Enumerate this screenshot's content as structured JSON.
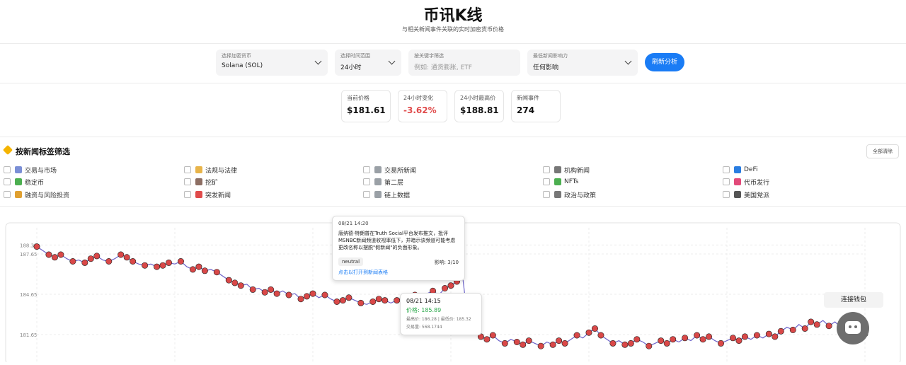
{
  "header": {
    "title": "币讯K线",
    "subtitle": "与相关新闻事件关联的实时加密货币价格"
  },
  "controls": {
    "currency": {
      "label": "选择加密货币",
      "value": "Solana (SOL)"
    },
    "timerange": {
      "label": "选择时间范围",
      "value": "24小时"
    },
    "keyword": {
      "label": "按关键字筛选",
      "placeholder": "例如: 通货膨胀, ETF"
    },
    "impact": {
      "label": "最低新闻影响力",
      "value": "任何影响"
    },
    "refresh_label": "刷新分析"
  },
  "stats": [
    {
      "label": "当前价格",
      "value": "$181.61"
    },
    {
      "label": "24小时变化",
      "value": "-3.62%"
    },
    {
      "label": "24小时最高价",
      "value": "$188.81"
    },
    {
      "label": "新闻事件",
      "value": "274"
    }
  ],
  "tags": {
    "title": "按新闻标签筛选",
    "clear_label": "全部清除",
    "items": [
      {
        "label": "交易与市场",
        "icon": "chart-icon",
        "color": "#7b8fd6"
      },
      {
        "label": "法规与法律",
        "icon": "scales-icon",
        "color": "#e8b44a"
      },
      {
        "label": "交易所新闻",
        "icon": "exchange-icon",
        "color": "#9aa0a6"
      },
      {
        "label": "机构新闻",
        "icon": "bank-icon",
        "color": "#777777"
      },
      {
        "label": "DeFi",
        "icon": "defi-icon",
        "color": "#2a7de1"
      },
      {
        "label": "稳定币",
        "icon": "money-icon",
        "color": "#4caf50"
      },
      {
        "label": "挖矿",
        "icon": "pick-icon",
        "color": "#8d6e63"
      },
      {
        "label": "第二层",
        "icon": "link-icon",
        "color": "#9aa0a6"
      },
      {
        "label": "NFTs",
        "icon": "nft-icon",
        "color": "#4caf50"
      },
      {
        "label": "代币发行",
        "icon": "rocket-icon",
        "color": "#e24a7a"
      },
      {
        "label": "融资与风险投资",
        "icon": "moneybag-icon",
        "color": "#e0a030"
      },
      {
        "label": "突发新闻",
        "icon": "alert-icon",
        "color": "#e04b4b"
      },
      {
        "label": "链上数据",
        "icon": "chain-icon",
        "color": "#9aa0a6"
      },
      {
        "label": "政治与政策",
        "icon": "bank-icon",
        "color": "#777777"
      },
      {
        "label": "美国党派",
        "icon": "us-icon",
        "color": "#555555"
      }
    ]
  },
  "chart_data": {
    "type": "line",
    "y_ticks": [
      "188.32",
      "187.65",
      "184.65",
      "181.65"
    ],
    "ylim": [
      179.6,
      189.6
    ],
    "grid": true,
    "series_color": "#6c63c9",
    "values": [
      188.2,
      187.9,
      187.6,
      187.4,
      187.6,
      187.3,
      187.1,
      187.2,
      187.0,
      187.3,
      187.5,
      187.2,
      187.1,
      187.3,
      187.6,
      187.4,
      187.1,
      186.9,
      186.8,
      186.9,
      186.7,
      186.8,
      187.0,
      186.9,
      187.1,
      186.7,
      186.5,
      186.7,
      186.4,
      186.5,
      186.3,
      186.0,
      185.7,
      185.5,
      185.3,
      185.4,
      185.0,
      185.1,
      184.8,
      185.0,
      184.7,
      184.9,
      184.6,
      184.7,
      184.3,
      184.5,
      184.7,
      184.4,
      184.6,
      184.3,
      184.1,
      184.2,
      184.4,
      184.2,
      184.0,
      183.9,
      184.1,
      184.3,
      184.2,
      184.0,
      184.2,
      184.4,
      184.3,
      184.6,
      184.4,
      184.7,
      184.9,
      184.6,
      185.1,
      185.3,
      185.6,
      185.8,
      182.0,
      181.9,
      181.5,
      181.3,
      181.6,
      181.2,
      181.0,
      181.3,
      181.1,
      180.9,
      181.2,
      181.0,
      180.8,
      181.1,
      180.9,
      181.2,
      181.0,
      181.3,
      181.6,
      181.4,
      181.8,
      182.1,
      181.6,
      181.3,
      181.0,
      181.2,
      180.9,
      181.0,
      181.3,
      181.1,
      180.8,
      181.0,
      181.2,
      181.0,
      181.3,
      181.1,
      181.4,
      181.2,
      181.6,
      181.3,
      181.5,
      181.2,
      181.0,
      181.2,
      181.4,
      181.2,
      181.5,
      181.3,
      181.6,
      181.4,
      181.7,
      181.5,
      181.9,
      182.2,
      182.0,
      182.4,
      182.1,
      182.6,
      182.4,
      182.7,
      182.3,
      182.6,
      182.2,
      182.5,
      182.1,
      181.9,
      181.7
    ]
  },
  "tooltip_news": {
    "time": "08/21 14:20",
    "text": "唐纳德·特朗普在Truth Social平台发布推文，批评MSNBC新闻频道收视率低下，并暗示该频道可能考虑更改名称以摆脱\"假新闻\"的负面形象。",
    "sentiment": "neutral",
    "impact": "影响: 3/10",
    "link": "点击以打开到新闻表格"
  },
  "tooltip_price": {
    "time": "08/21 14:15",
    "price": "价格: 185.89",
    "hl": "最高价: 186.28 | 最低价: 185.32",
    "volume": "交易量: 568.1744"
  },
  "wallet_label": "连接钱包"
}
